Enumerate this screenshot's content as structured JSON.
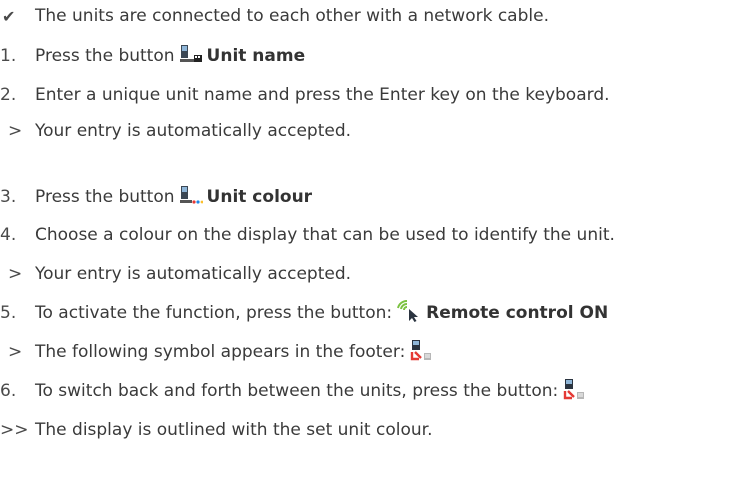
{
  "steps": [
    {
      "marker": "✔",
      "text": "The units are connected to each other with a network cable."
    },
    {
      "marker": "1.",
      "text": "Press the button",
      "icon": "unit-name-icon",
      "bold": "Unit name"
    },
    {
      "marker": "2.",
      "text": "Enter a unique unit name and press the Enter key on the keyboard."
    },
    {
      "marker": ">",
      "text": "Your entry is automatically accepted."
    },
    {
      "marker": "3.",
      "text": "Press the button",
      "icon": "unit-colour-icon",
      "bold": "Unit colour"
    },
    {
      "marker": "4.",
      "text": "Choose a colour on the display that can be used to identify the unit."
    },
    {
      "marker": ">",
      "text": "Your entry is automatically accepted."
    },
    {
      "marker": "5.",
      "text": "To activate the function, press the button:",
      "icon": "remote-control-icon",
      "bold": "Remote control ON"
    },
    {
      "marker": ">",
      "text": "The following symbol appears in the footer:",
      "icon": "remote-footer-icon"
    },
    {
      "marker": "6.",
      "text": "To switch back and forth between the units, press the button:",
      "icon": "switch-units-icon"
    },
    {
      "marker": ">>",
      "text": "The display is outlined with the set unit colour."
    }
  ]
}
